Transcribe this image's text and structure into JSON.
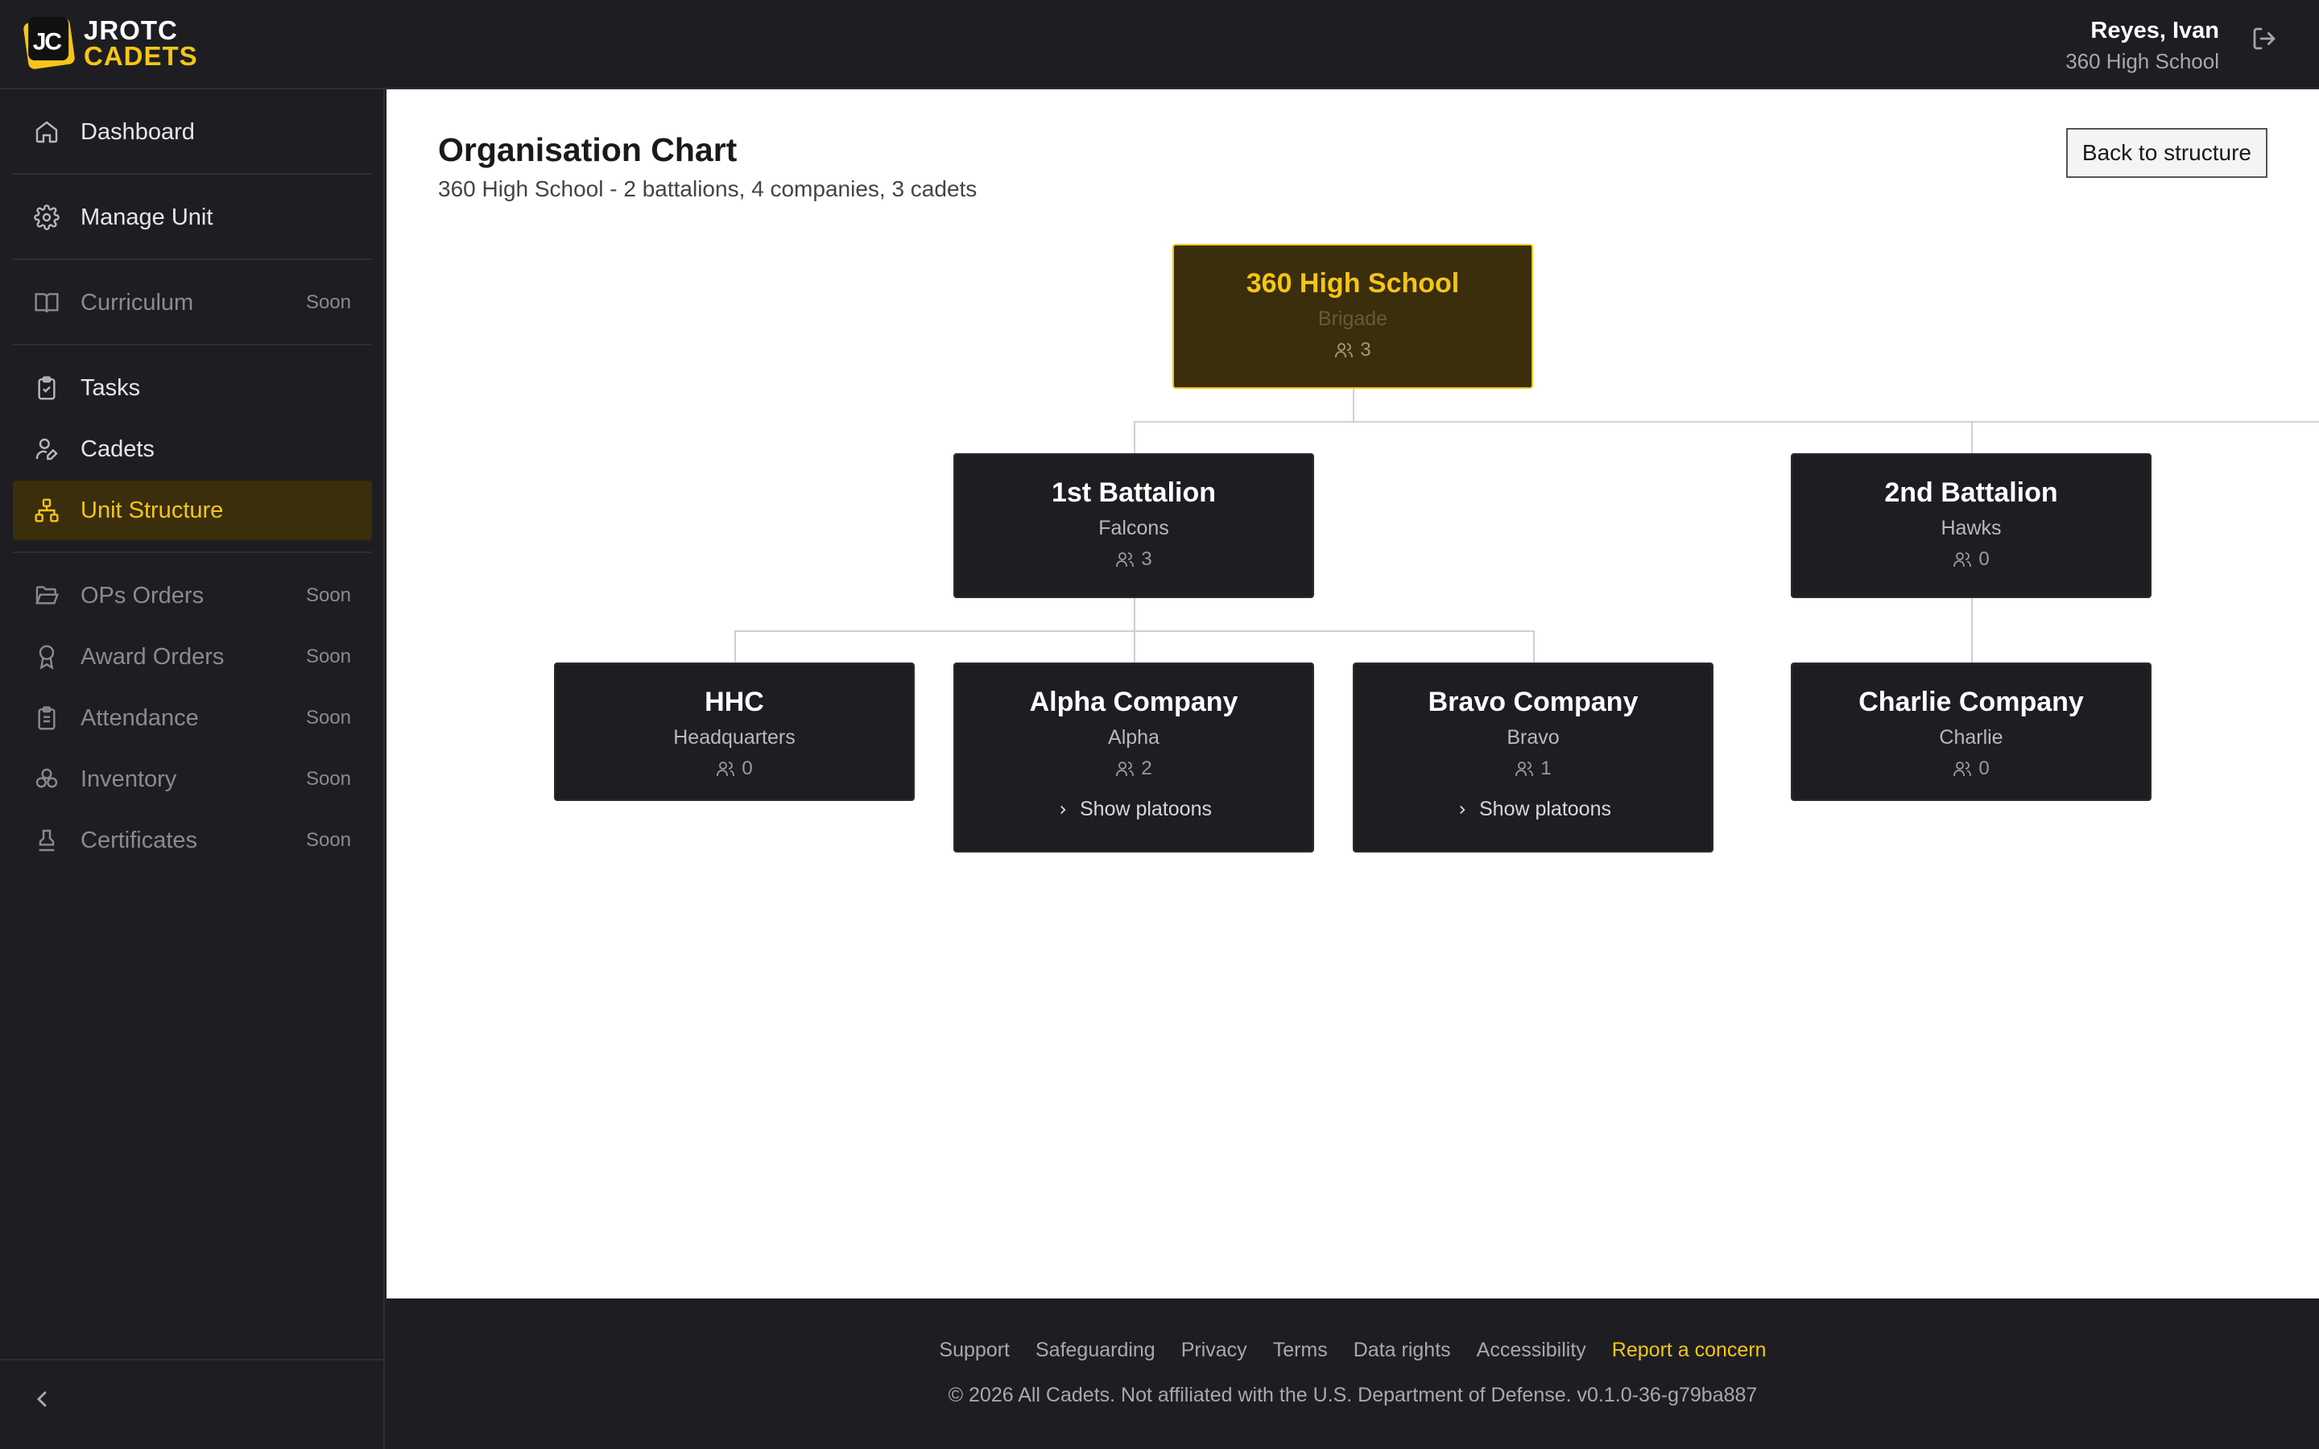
{
  "brand": {
    "badge": "JC",
    "line1": "JROTC",
    "line2": "CADETS"
  },
  "user": {
    "name": "Reyes, Ivan",
    "school": "360 High School"
  },
  "nav": {
    "dashboard": "Dashboard",
    "manage_unit": "Manage Unit",
    "curriculum": "Curriculum",
    "tasks": "Tasks",
    "cadets": "Cadets",
    "unit_structure": "Unit Structure",
    "ops_orders": "OPs Orders",
    "award_orders": "Award Orders",
    "attendance": "Attendance",
    "inventory": "Inventory",
    "certificates": "Certificates",
    "soon": "Soon"
  },
  "page": {
    "title": "Organisation Chart",
    "subtitle": "360 High School - 2 battalions, 4 companies, 3 cadets",
    "back_button": "Back to structure"
  },
  "org": {
    "root": {
      "name": "360 High School",
      "type": "Brigade",
      "count": "3"
    },
    "bn1": {
      "name": "1st Battalion",
      "type": "Falcons",
      "count": "3"
    },
    "bn2": {
      "name": "2nd Battalion",
      "type": "Hawks",
      "count": "0"
    },
    "hhc": {
      "name": "HHC",
      "type": "Headquarters",
      "count": "0"
    },
    "alpha": {
      "name": "Alpha Company",
      "type": "Alpha",
      "count": "2",
      "action": "Show platoons"
    },
    "bravo": {
      "name": "Bravo Company",
      "type": "Bravo",
      "count": "1",
      "action": "Show platoons"
    },
    "charlie": {
      "name": "Charlie Company",
      "type": "Charlie",
      "count": "0"
    }
  },
  "footer": {
    "support": "Support",
    "safeguarding": "Safeguarding",
    "privacy": "Privacy",
    "terms": "Terms",
    "data_rights": "Data rights",
    "accessibility": "Accessibility",
    "report": "Report a concern",
    "copyright": "© 2026 All Cadets. Not affiliated with the U.S. Department of Defense. v0.1.0-36-g79ba887"
  },
  "colors": {
    "accent": "#f5c518",
    "sidebar_bg": "#1e1e22",
    "active_bg": "#3a2e0c"
  }
}
